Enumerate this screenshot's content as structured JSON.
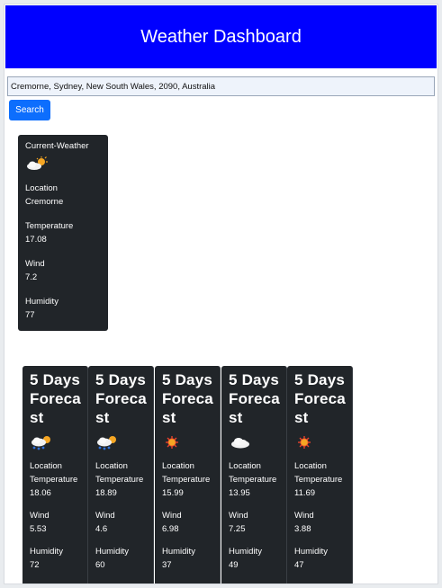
{
  "header": {
    "title": "Weather Dashboard"
  },
  "search": {
    "value": "Cremorne, Sydney, New South Wales, 2090, Australia",
    "button_label": "Search"
  },
  "current": {
    "title": "Current-Weather",
    "icon": "partly-cloudy-icon",
    "location_label": "Location",
    "location": "Cremorne",
    "temperature_label": "Temperature",
    "temperature": "17.08",
    "wind_label": "Wind",
    "wind": "7.2",
    "humidity_label": "Humidity",
    "humidity": "77"
  },
  "forecast": [
    {
      "title": "5 Days Forecast",
      "icon": "rain-sun-icon",
      "location_label": "Location",
      "temperature_label": "Temperature",
      "temperature": "18.06",
      "wind_label": "Wind",
      "wind": "5.53",
      "humidity_label": "Humidity",
      "humidity": "72"
    },
    {
      "title": "5 Days Forecast",
      "icon": "rain-sun-icon",
      "location_label": "Location",
      "temperature_label": "Temperature",
      "temperature": "18.89",
      "wind_label": "Wind",
      "wind": "4.6",
      "humidity_label": "Humidity",
      "humidity": "60"
    },
    {
      "title": "5 Days Forecast",
      "icon": "sun-icon",
      "location_label": "Location",
      "temperature_label": "Temperature",
      "temperature": "15.99",
      "wind_label": "Wind",
      "wind": "6.98",
      "humidity_label": "Humidity",
      "humidity": "37"
    },
    {
      "title": "5 Days Forecast",
      "icon": "cloud-icon",
      "location_label": "Location",
      "temperature_label": "Temperature",
      "temperature": "13.95",
      "wind_label": "Wind",
      "wind": "7.25",
      "humidity_label": "Humidity",
      "humidity": "49"
    },
    {
      "title": "5 Days Forecast",
      "icon": "sun-icon",
      "location_label": "Location",
      "temperature_label": "Temperature",
      "temperature": "11.69",
      "wind_label": "Wind",
      "wind": "3.88",
      "humidity_label": "Humidity",
      "humidity": "47"
    }
  ],
  "colors": {
    "header": "#0000ff",
    "button": "#0d6efd",
    "card": "#212529"
  }
}
